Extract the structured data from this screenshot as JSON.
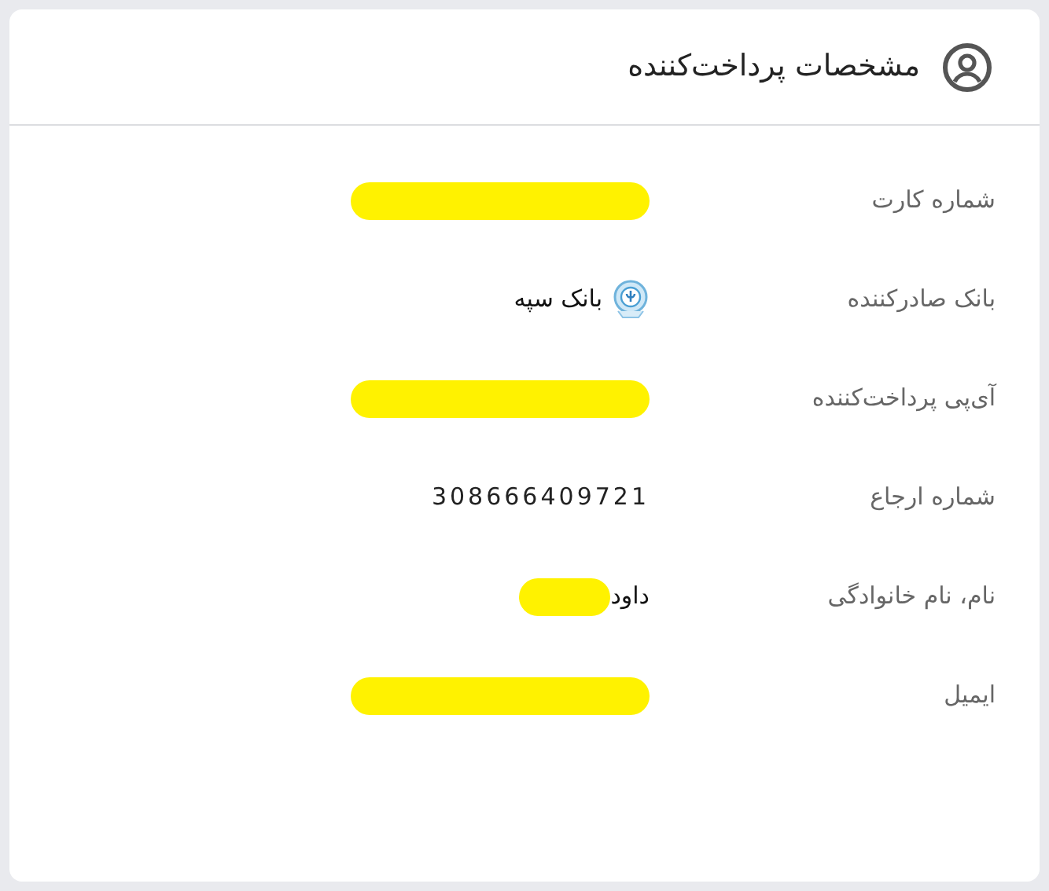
{
  "card": {
    "title": "مشخصات پرداخت‌کننده"
  },
  "rows": [
    {
      "label": "شماره کارت",
      "kind": "redacted"
    },
    {
      "label": "بانک صادرکننده",
      "kind": "bank",
      "value": "بانک سپه"
    },
    {
      "label": "آی‌پی پرداخت‌کننده",
      "kind": "redacted"
    },
    {
      "label": "شماره ارجاع",
      "kind": "number",
      "value": "308666409721"
    },
    {
      "label": "نام، نام خانوادگی",
      "kind": "partly_redacted",
      "value": "داود"
    },
    {
      "label": "ایمیل",
      "kind": "redacted"
    }
  ]
}
